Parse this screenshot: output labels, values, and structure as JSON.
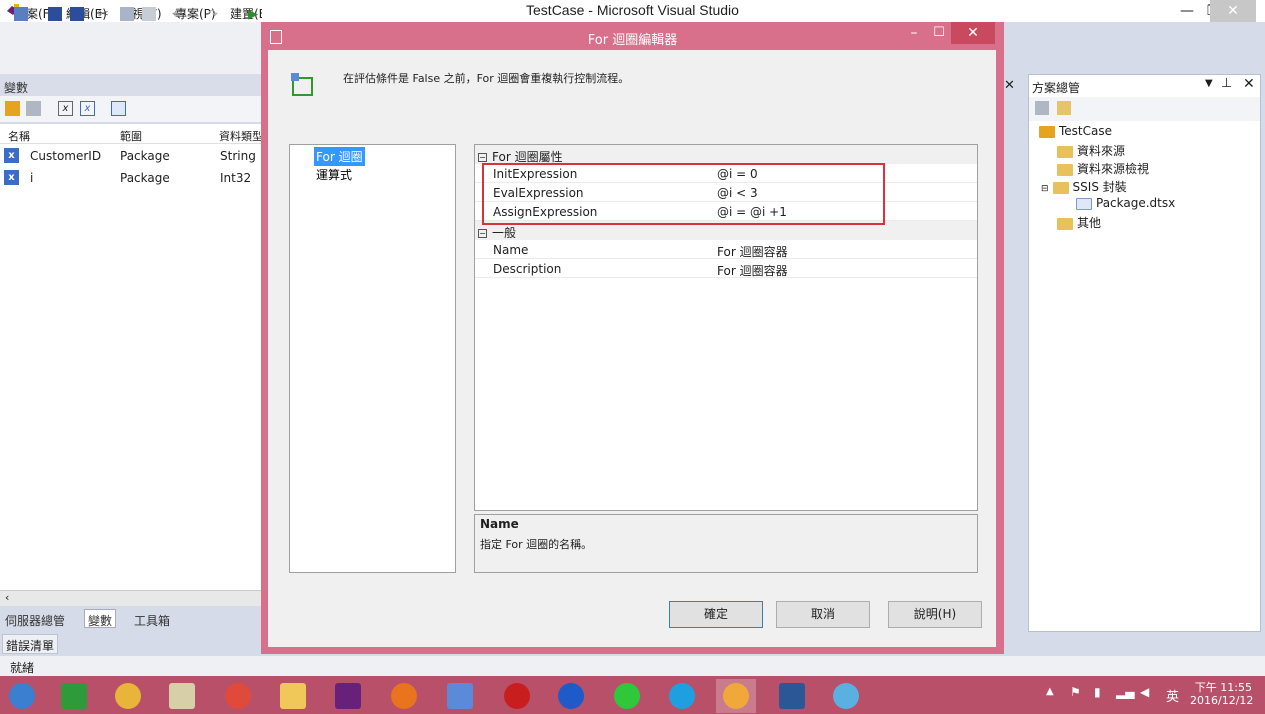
{
  "window": {
    "title": "TestCase - Microsoft Visual Studio",
    "minimize": "—",
    "restore": "❐",
    "close": "✕"
  },
  "menu": {
    "items": [
      "檔案(F)",
      "編輯(E)",
      "檢視(V)",
      "專案(P)",
      "建置(B)"
    ]
  },
  "variables": {
    "header": "變數",
    "columns": [
      "名稱",
      "範圍",
      "資料類型"
    ],
    "rows": [
      {
        "name": "CustomerID",
        "scope": "Package",
        "type": "String"
      },
      {
        "name": "i",
        "scope": "Package",
        "type": "Int32"
      }
    ],
    "tabs": [
      "伺服器總管",
      "變數",
      "工具箱"
    ],
    "error_list": "錯誤清單"
  },
  "status": {
    "text": "就緒"
  },
  "solution": {
    "header": "方案總管",
    "tree": [
      "TestCase",
      "資料來源",
      "資料來源檢視",
      "SSIS 封裝",
      "Package.dtsx",
      "其他"
    ]
  },
  "dialog": {
    "title": "For 迴圈編輯器",
    "description": "在評估條件是 False 之前，For 迴圈會重複執行控制流程。",
    "nav": [
      "For 迴圈",
      "運算式"
    ],
    "categories": [
      {
        "name": "For 迴圈屬性",
        "props": [
          {
            "name": "InitExpression",
            "value": "@i = 0"
          },
          {
            "name": "EvalExpression",
            "value": "@i < 3"
          },
          {
            "name": "AssignExpression",
            "value": "@i = @i +1"
          }
        ]
      },
      {
        "name": "一般",
        "props": [
          {
            "name": "Name",
            "value": "For 迴圈容器"
          },
          {
            "name": "Description",
            "value": "For 迴圈容器"
          }
        ]
      }
    ],
    "help": {
      "title": "Name",
      "text": "指定 For 迴圈的名稱。"
    },
    "buttons": {
      "ok": "確定",
      "cancel": "取消",
      "help": "說明(H)"
    }
  },
  "tray": {
    "ime": "英",
    "time": "下午 11:55",
    "date": "2016/12/12"
  },
  "colors": {
    "dialog_frame": "#d8708c",
    "highlight_box": "#d8323c",
    "selection": "#3399ff",
    "taskbar": "#b8506a"
  }
}
